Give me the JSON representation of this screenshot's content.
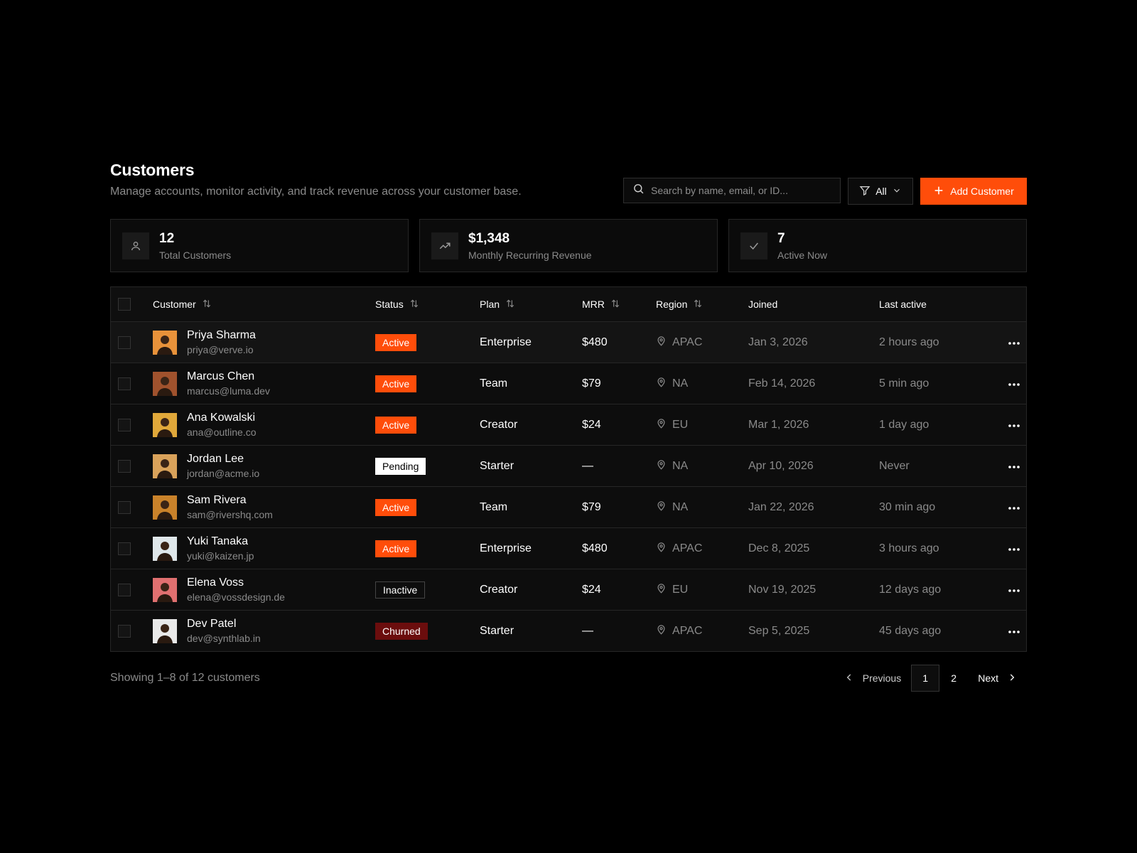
{
  "header": {
    "title": "Customers",
    "subtitle": "Manage accounts, monitor activity, and track revenue across your customer base."
  },
  "search": {
    "placeholder": "Search by name, email, or ID..."
  },
  "filter": {
    "label": "All"
  },
  "add_button": {
    "label": "Add Customer"
  },
  "accent_color": "#ff4d0a",
  "stats": [
    {
      "value": "12",
      "label": "Total Customers",
      "icon": "user-icon"
    },
    {
      "value": "$1,348",
      "label": "Monthly Recurring Revenue",
      "icon": "trending-up-icon"
    },
    {
      "value": "7",
      "label": "Active Now",
      "icon": "check-icon"
    }
  ],
  "table": {
    "columns": [
      "Customer",
      "Status",
      "Plan",
      "MRR",
      "Region",
      "Joined",
      "Last active"
    ],
    "rows": [
      {
        "name": "Priya Sharma",
        "email": "priya@verve.io",
        "status": "Active",
        "plan": "Enterprise",
        "mrr": "$480",
        "region": "APAC",
        "joined": "Jan 3, 2026",
        "last_active": "2 hours ago"
      },
      {
        "name": "Marcus Chen",
        "email": "marcus@luma.dev",
        "status": "Active",
        "plan": "Team",
        "mrr": "$79",
        "region": "NA",
        "joined": "Feb 14, 2026",
        "last_active": "5 min ago"
      },
      {
        "name": "Ana Kowalski",
        "email": "ana@outline.co",
        "status": "Active",
        "plan": "Creator",
        "mrr": "$24",
        "region": "EU",
        "joined": "Mar 1, 2026",
        "last_active": "1 day ago"
      },
      {
        "name": "Jordan Lee",
        "email": "jordan@acme.io",
        "status": "Pending",
        "plan": "Starter",
        "mrr": "—",
        "region": "NA",
        "joined": "Apr 10, 2026",
        "last_active": "Never"
      },
      {
        "name": "Sam Rivera",
        "email": "sam@rivershq.com",
        "status": "Active",
        "plan": "Team",
        "mrr": "$79",
        "region": "NA",
        "joined": "Jan 22, 2026",
        "last_active": "30 min ago"
      },
      {
        "name": "Yuki Tanaka",
        "email": "yuki@kaizen.jp",
        "status": "Active",
        "plan": "Enterprise",
        "mrr": "$480",
        "region": "APAC",
        "joined": "Dec 8, 2025",
        "last_active": "3 hours ago"
      },
      {
        "name": "Elena Voss",
        "email": "elena@vossdesign.de",
        "status": "Inactive",
        "plan": "Creator",
        "mrr": "$24",
        "region": "EU",
        "joined": "Nov 19, 2025",
        "last_active": "12 days ago"
      },
      {
        "name": "Dev Patel",
        "email": "dev@synthlab.in",
        "status": "Churned",
        "plan": "Starter",
        "mrr": "—",
        "region": "APAC",
        "joined": "Sep 5, 2025",
        "last_active": "45 days ago"
      }
    ]
  },
  "footer": {
    "showing": "Showing 1–8 of 12 customers",
    "previous": "Previous",
    "next": "Next",
    "pages": [
      "1",
      "2"
    ]
  }
}
